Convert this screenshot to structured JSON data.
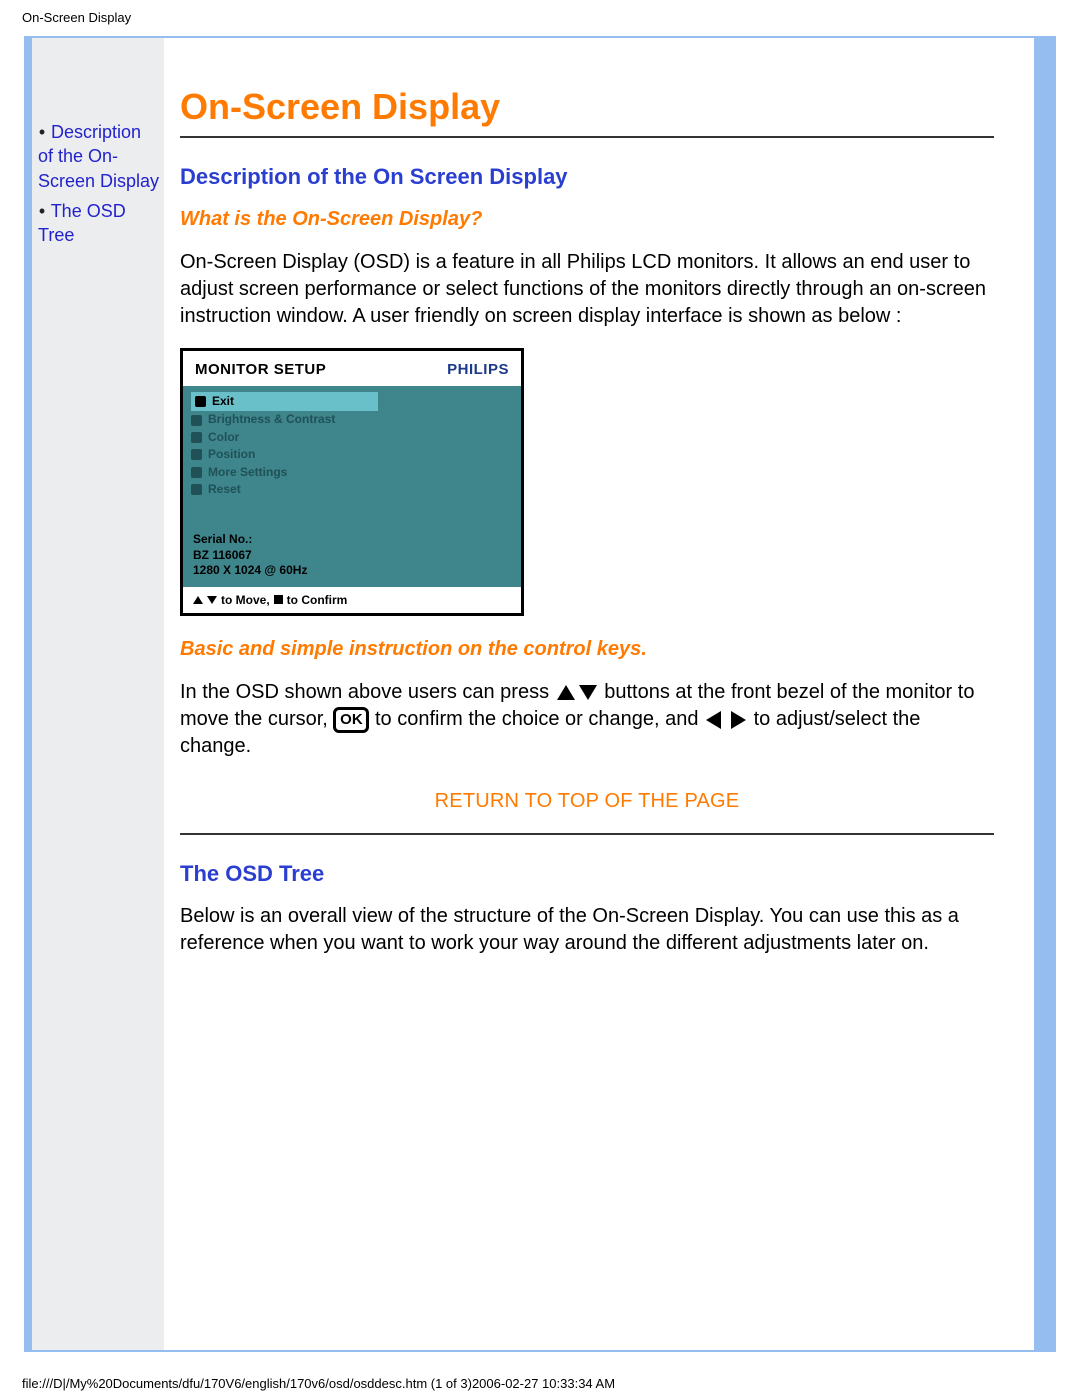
{
  "meta": {
    "top_title": "On-Screen Display",
    "footer": "file:///D|/My%20Documents/dfu/170V6/english/170v6/osd/osddesc.htm (1 of 3)2006-02-27 10:33:34 AM"
  },
  "sidenav": {
    "items": [
      {
        "label": "Description of the On-Screen Display"
      },
      {
        "label": "The OSD Tree"
      }
    ]
  },
  "main": {
    "h1": "On-Screen Display",
    "desc_heading": "Description of the On Screen Display",
    "q_heading": "What is the On-Screen Display?",
    "desc_body": "On-Screen Display (OSD) is a feature in all Philips LCD monitors. It allows an end user to adjust screen performance or select functions of the monitors directly through an on-screen instruction window. A user friendly on screen display interface is shown as below :",
    "instr_heading": "Basic and simple instruction on the control keys.",
    "instr_segments": {
      "s1": "In the OSD shown above users can press",
      "s2": " buttons at the front bezel of the monitor to move the cursor, ",
      "s3": " to confirm the choice or change, and ",
      "s4": " to adjust/select the change."
    },
    "ok_label": "OK",
    "return_link": "RETURN TO TOP OF THE PAGE",
    "tree_heading": "The OSD Tree",
    "tree_body": "Below is an overall view of the structure of the On-Screen Display. You can use this as a reference when you want to work your way around the different adjustments later on."
  },
  "osd": {
    "title": "MONITOR SETUP",
    "brand": "PHILIPS",
    "menu": [
      "Exit",
      "Brightness & Contrast",
      "Color",
      "Position",
      "More Settings",
      "Reset"
    ],
    "serial_label": "Serial No.:",
    "serial_value": "BZ 116067",
    "resolution": "1280 X 1024 @ 60Hz",
    "footer_move": " to Move, ",
    "footer_confirm": " to Confirm"
  }
}
